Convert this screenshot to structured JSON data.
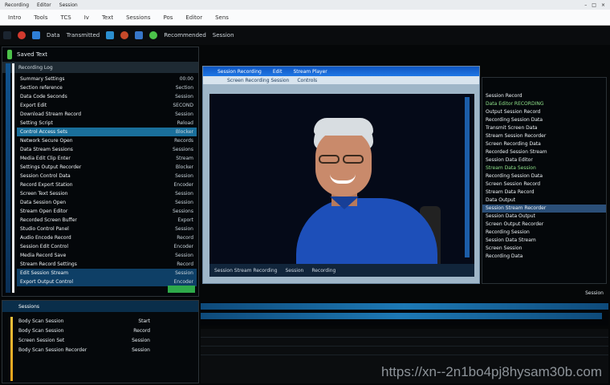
{
  "titlebar": {
    "items": [
      "Recording",
      "Editor",
      "Session"
    ],
    "window_controls": [
      "–",
      "□",
      "×"
    ]
  },
  "menubar": {
    "items": [
      "Intro",
      "Tools",
      "TCS",
      "Iv",
      "Text",
      "Sessions",
      "Pos",
      "Editor",
      "Sens"
    ]
  },
  "toolbar": {
    "label_a": "Data",
    "label_b": "Transmitted",
    "label_c": "Recommended",
    "label_d": "Session",
    "colors": {
      "green": "#4cc24a",
      "blue": "#2f7fd6",
      "red": "#d23a2e"
    }
  },
  "left_panel": {
    "title": "Saved Text",
    "subtitle": "Recording Log",
    "rows": [
      {
        "text": "Summary Settings",
        "val": "00:00"
      },
      {
        "text": "Section reference",
        "val": "Section"
      },
      {
        "text": "Data Code Seconds",
        "val": "Session"
      },
      {
        "text": "Export Edit",
        "val": "SECOND"
      },
      {
        "text": "Download Stream Record",
        "val": "Session"
      },
      {
        "text": "Setting Script",
        "val": "Reload"
      },
      {
        "text": "Control Access Sets",
        "val": "Blocker"
      },
      {
        "text": "Network Secure Open",
        "val": "Records"
      },
      {
        "text": "Data Stream Sessions",
        "val": "Sessions"
      },
      {
        "text": "Media Edit Clip Enter",
        "val": "Stream"
      },
      {
        "text": "Settings Output Recorder",
        "val": "Blocker"
      },
      {
        "text": "Session Control Data",
        "val": "Session"
      },
      {
        "text": "Record Export Station",
        "val": "Encoder"
      },
      {
        "text": "Screen Text Session",
        "val": "Session"
      },
      {
        "text": "Data Session Open",
        "val": "Session"
      },
      {
        "text": "Stream Open Editor",
        "val": "Sessions"
      },
      {
        "text": "Recorded Screen Buffer",
        "val": "Export"
      },
      {
        "text": "Studio Control Panel",
        "val": "Session"
      },
      {
        "text": "Audio Encode Record",
        "val": "Record"
      },
      {
        "text": "Session Edit Control",
        "val": "Encoder"
      },
      {
        "text": "Media Record Save",
        "val": "Session"
      },
      {
        "text": "Stream Record Settings",
        "val": "Record"
      },
      {
        "text": "Edit Session Stream",
        "val": "Session"
      },
      {
        "text": "Export Output Control",
        "val": "Encoder"
      }
    ]
  },
  "viewer": {
    "title_items": [
      "Session Recording",
      "Edit",
      "Stream Player"
    ],
    "tool_items": [
      "Screen Recording Session",
      "Controls"
    ],
    "status_items": [
      "Session Stream Recording",
      "Session",
      "Recording"
    ]
  },
  "right_panel": {
    "rows": [
      {
        "text": "Session Record",
        "cls": ""
      },
      {
        "text": "Data Editor      RECORDING",
        "cls": "g"
      },
      {
        "text": "Output Session Record",
        "cls": ""
      },
      {
        "text": "Recording Session Data",
        "cls": ""
      },
      {
        "text": "Transmit Screen Data",
        "cls": ""
      },
      {
        "text": "Stream Session    Recorder",
        "cls": ""
      },
      {
        "text": "Screen Recording Data",
        "cls": ""
      },
      {
        "text": "Recorded Session Stream",
        "cls": ""
      },
      {
        "text": "Session Data Editor",
        "cls": ""
      },
      {
        "text": "Stream Data Session",
        "cls": "g"
      },
      {
        "text": "Recording Session Data",
        "cls": ""
      },
      {
        "text": "Screen Session Record",
        "cls": ""
      },
      {
        "text": "Stream Data Record",
        "cls": ""
      },
      {
        "text": "Data Output",
        "cls": ""
      },
      {
        "text": "Session Stream Recorder",
        "cls": "hl"
      },
      {
        "text": "Session Data Output",
        "cls": ""
      },
      {
        "text": "Screen Output Recorder",
        "cls": ""
      },
      {
        "text": "Recording Session",
        "cls": ""
      },
      {
        "text": "Session Data Stream",
        "cls": ""
      },
      {
        "text": "Screen Session",
        "cls": ""
      },
      {
        "text": "Recording Data",
        "cls": ""
      }
    ]
  },
  "bottom_panel": {
    "header": "Sessions",
    "rows": [
      {
        "a": "Body Scan Session",
        "b": "Start"
      },
      {
        "a": "Body Scan Session",
        "b": "Record"
      },
      {
        "a": "Screen Session Set",
        "b": "Session"
      },
      {
        "a": "Body Scan Session Recorder",
        "b": "Session"
      }
    ]
  },
  "corner_label": "Session",
  "watermark": "https://xn--2n1bo4pj8hysam30b.com"
}
